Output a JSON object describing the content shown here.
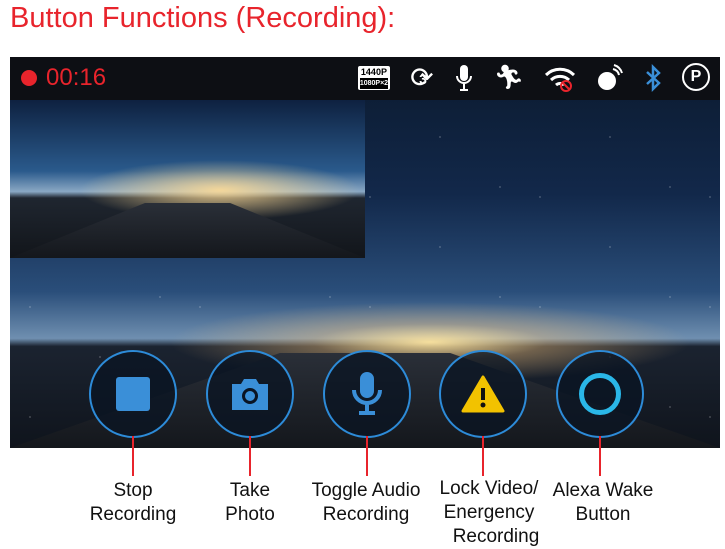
{
  "title": "Button Functions (Recording):",
  "status_bar": {
    "timer": "00:16",
    "resolution_top": "1440P",
    "resolution_bottom": "1080P×2",
    "loop_value": "3",
    "parking_label": "P",
    "icons": [
      "record-dot-icon",
      "resolution-icon",
      "loop-recording-icon",
      "microphone-icon",
      "motion-detection-icon",
      "wifi-off-icon",
      "gps-icon",
      "bluetooth-icon",
      "parking-mode-icon"
    ]
  },
  "buttons": [
    {
      "name": "stop-recording",
      "label": "Stop Recording",
      "line1": "Stop",
      "line2": "Recording",
      "line3": ""
    },
    {
      "name": "take-photo",
      "label": "Take Photo",
      "line1": "Take",
      "line2": "Photo",
      "line3": ""
    },
    {
      "name": "toggle-audio",
      "label": "Toggle Audio Recording",
      "line1": "Toggle Audio",
      "line2": "Recording",
      "line3": ""
    },
    {
      "name": "lock-video",
      "label": "Lock Video/ Energency Recording",
      "line1": "Lock Video/",
      "line2": "Energency",
      "line3": "Recording"
    },
    {
      "name": "alexa-wake",
      "label": "Alexa Wake Button",
      "line1": "Alexa Wake",
      "line2": "Button",
      "line3": ""
    }
  ],
  "colors": {
    "accent": "#e8242c",
    "button_ring": "#2d8bd8",
    "icon_blue": "#3a8fd8",
    "warning": "#f2c200"
  }
}
